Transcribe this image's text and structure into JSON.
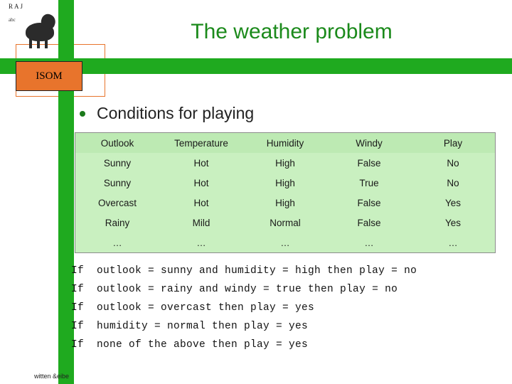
{
  "slide": {
    "title": "The weather problem",
    "bullet": "Conditions for playing",
    "logo": {
      "brand": "RAJ",
      "sub": "abc",
      "animal_icon": "sheep-icon"
    },
    "isom_label": "ISOM",
    "footer_left": "witten",
    "footer_right": "&eibe"
  },
  "table": {
    "headers": [
      "Outlook",
      "Temperature",
      "Humidity",
      "Windy",
      "Play"
    ],
    "rows": [
      [
        "Sunny",
        "Hot",
        "High",
        "False",
        "No"
      ],
      [
        "Sunny",
        "Hot",
        "High",
        "True",
        "No"
      ],
      [
        "Overcast",
        "Hot",
        "High",
        "False",
        "Yes"
      ],
      [
        "Rainy",
        "Mild",
        "Normal",
        "False",
        "Yes"
      ],
      [
        "…",
        "…",
        "…",
        "…",
        "…"
      ]
    ]
  },
  "rules": [
    "If  outlook = sunny and humidity = high then play = no",
    "If  outlook = rainy and windy = true then play = no",
    "If  outlook = overcast then play = yes",
    "If  humidity = normal then play = yes",
    "If  none of the above then play = yes"
  ],
  "colors": {
    "green_bar": "#1faa1f",
    "title_green": "#1b8a1b",
    "table_bg": "#c9f0c0",
    "table_header_bg": "#bdeab3",
    "orange": "#e8742c"
  }
}
